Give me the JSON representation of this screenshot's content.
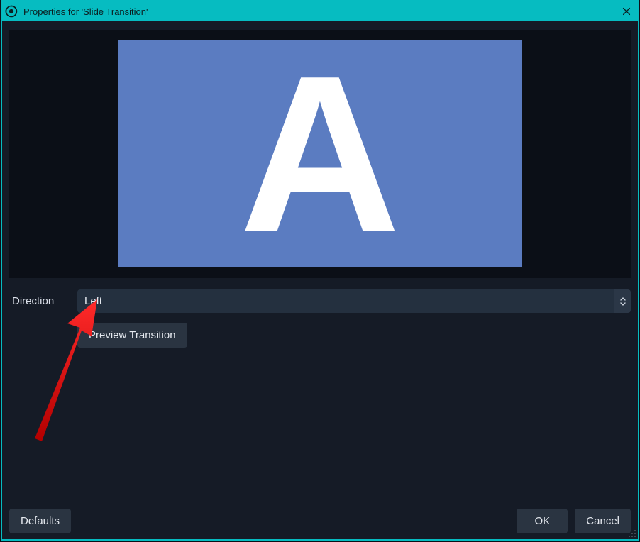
{
  "window": {
    "title": "Properties for 'Slide Transition'"
  },
  "preview": {
    "letter": "A"
  },
  "form": {
    "direction_label": "Direction",
    "direction_value": "Left",
    "preview_button": "Preview Transition"
  },
  "footer": {
    "defaults": "Defaults",
    "ok": "OK",
    "cancel": "Cancel"
  },
  "colors": {
    "accent": "#06bcc1",
    "preview_bg": "#5b7cc1",
    "panel": "#151b26",
    "control": "#24303f"
  }
}
